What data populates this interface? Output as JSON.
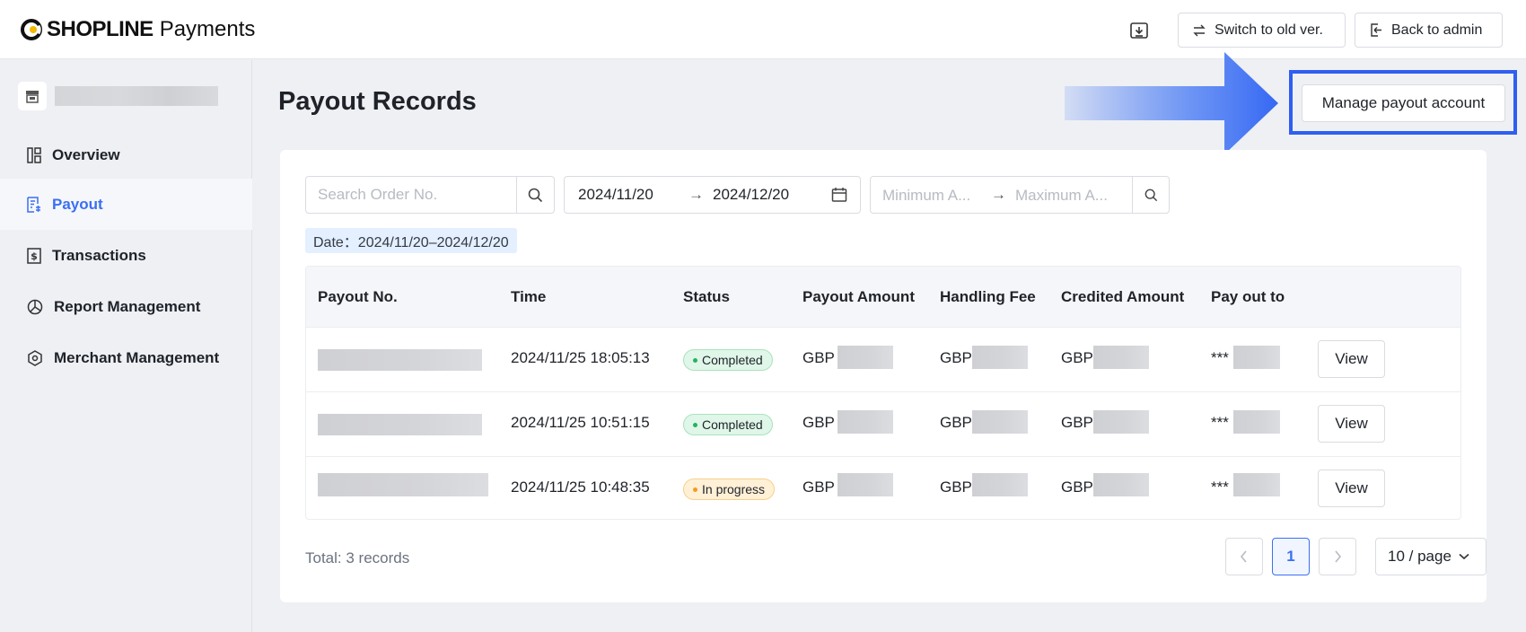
{
  "header": {
    "brand": "SHOPLINE",
    "product": "Payments",
    "download_icon": "download-icon",
    "switch_label": "Switch to old ver.",
    "back_label": "Back to admin"
  },
  "sidebar": {
    "store_icon": "store-icon",
    "items": [
      {
        "label": "Overview",
        "icon": "dashboard-icon"
      },
      {
        "label": "Payout",
        "icon": "payout-doc-icon"
      },
      {
        "label": "Transactions",
        "icon": "dollar-doc-icon"
      },
      {
        "label": "Report Management",
        "icon": "pie-chart-icon"
      },
      {
        "label": "Merchant Management",
        "icon": "hexagon-settings-icon"
      }
    ],
    "active_index": 1
  },
  "main": {
    "title": "Payout Records",
    "manage_label": "Manage payout account",
    "filters": {
      "search_placeholder": "Search Order No.",
      "date_start": "2024/11/20",
      "date_arrow": "→",
      "date_end": "2024/12/20",
      "amount_min_placeholder": "Minimum A...",
      "amount_max_placeholder": "Maximum A...",
      "date_tag": "Date：2024/11/20–2024/12/20"
    },
    "table": {
      "columns": [
        "Payout No.",
        "Time",
        "Status",
        "Payout Amount",
        "Handling Fee",
        "Credited Amount",
        "Pay out to"
      ],
      "rows": [
        {
          "time": "2024/11/25 18:05:13",
          "status": "Completed",
          "status_type": "done",
          "payout_cur": "GBP",
          "fee_cur": "GBP",
          "credited_cur": "GBP",
          "pay_to": "***",
          "action": "View"
        },
        {
          "time": "2024/11/25 10:51:15",
          "status": "Completed",
          "status_type": "done",
          "payout_cur": "GBP",
          "fee_cur": "GBP",
          "credited_cur": "GBP",
          "pay_to": "***",
          "action": "View"
        },
        {
          "time": "2024/11/25 10:48:35",
          "status": "In progress",
          "status_type": "prog",
          "payout_cur": "GBP",
          "fee_cur": "GBP",
          "credited_cur": "GBP",
          "pay_to": "***",
          "action": "View"
        }
      ]
    },
    "footer": {
      "total": "Total: 3 records",
      "current_page": "1",
      "page_size": "10 / page"
    }
  },
  "colors": {
    "accent": "#3b6ff2",
    "highlight_border": "#2f5ef0",
    "completed": "#22b45e",
    "in_progress": "#f59a23"
  }
}
